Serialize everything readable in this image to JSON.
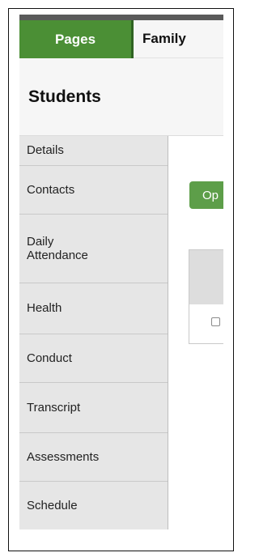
{
  "tabs": [
    {
      "label": "Pages",
      "active": true
    },
    {
      "label": "Family",
      "active": false
    }
  ],
  "header": {
    "title": "Students"
  },
  "sidebar": {
    "items": [
      {
        "label": "Details"
      },
      {
        "label": "Contacts"
      },
      {
        "label": "Daily Attendance"
      },
      {
        "label": "Health"
      },
      {
        "label": "Conduct"
      },
      {
        "label": "Transcript"
      },
      {
        "label": "Assessments"
      },
      {
        "label": "Schedule"
      }
    ]
  },
  "content": {
    "button_label": "Op"
  },
  "colors": {
    "accent_green": "#4b8f35",
    "button_green": "#5d9e49",
    "sidebar_bg": "#e6e6e6"
  }
}
